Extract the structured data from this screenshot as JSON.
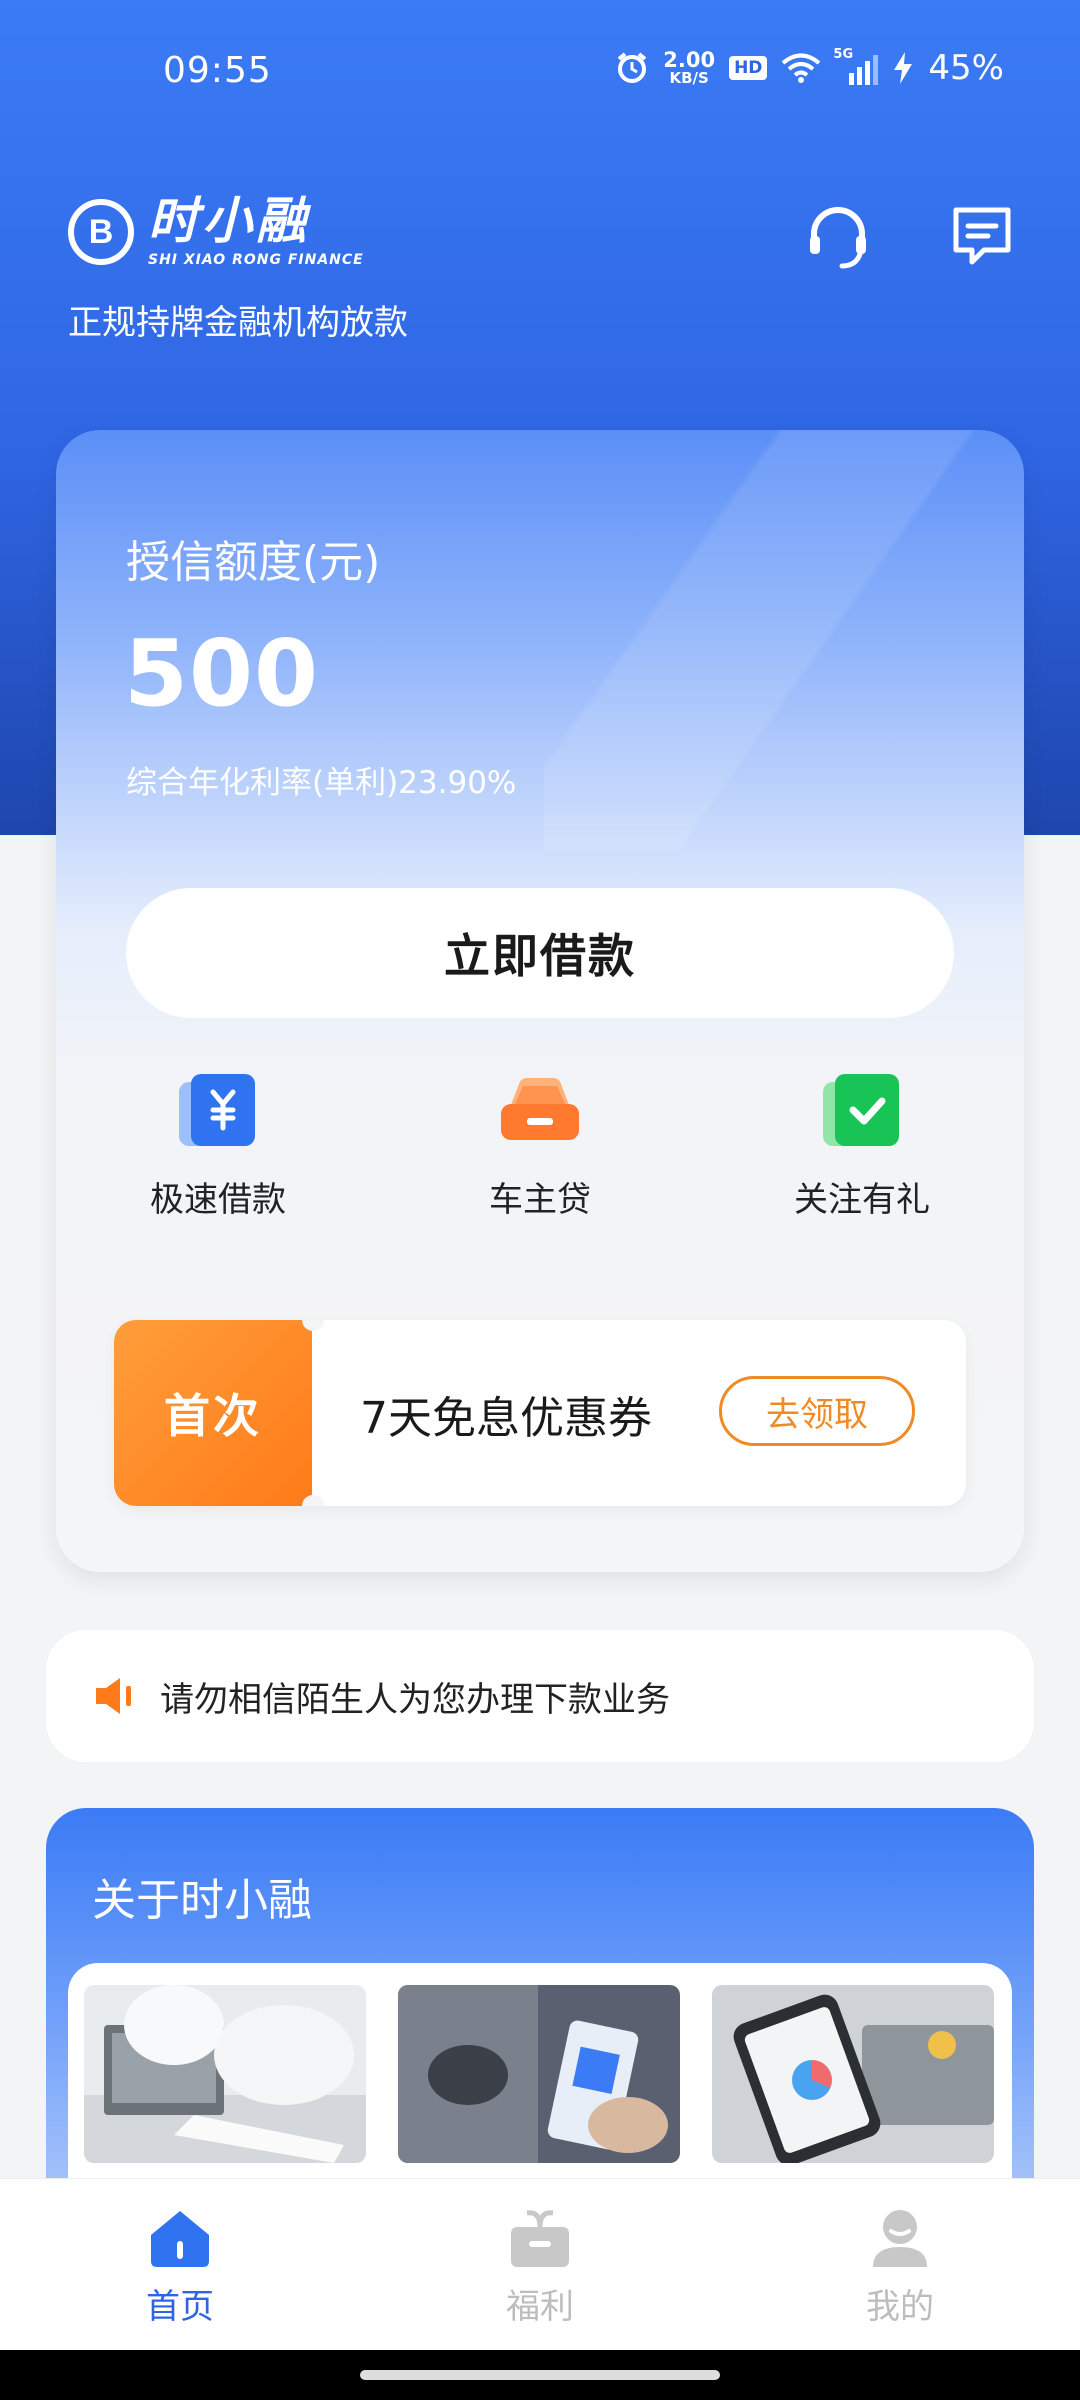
{
  "status_bar": {
    "time": "09:55",
    "net_speed_value": "2.00",
    "net_speed_unit": "KB/S",
    "hd_label": "HD",
    "network_label": "5G",
    "battery": "45%"
  },
  "header": {
    "brand_cn": "时小融",
    "brand_en": "SHI XIAO RONG FINANCE",
    "tagline": "正规持牌金融机构放款"
  },
  "credit_card": {
    "title": "授信额度(元)",
    "amount": "500",
    "rate": "综合年化利率(单利)23.90%",
    "borrow_button": "立即借款"
  },
  "quick_actions": [
    {
      "label": "极速借款",
      "icon": "yuan-card-icon"
    },
    {
      "label": "车主贷",
      "icon": "car-icon"
    },
    {
      "label": "关注有礼",
      "icon": "check-icon"
    }
  ],
  "coupon": {
    "tag": "首次",
    "text": "7天免息优惠券",
    "button": "去领取"
  },
  "notice": {
    "text": "请勿相信陌生人为您办理下款业务"
  },
  "about": {
    "title": "关于时小融"
  },
  "bottom_nav": [
    {
      "label": "首页",
      "icon": "home-icon",
      "active": true
    },
    {
      "label": "福利",
      "icon": "gift-icon",
      "active": false
    },
    {
      "label": "我的",
      "icon": "profile-icon",
      "active": false
    }
  ],
  "colors": {
    "primary": "#2f65e3",
    "accent_orange": "#f08a24",
    "inactive": "#bdbdbd"
  }
}
